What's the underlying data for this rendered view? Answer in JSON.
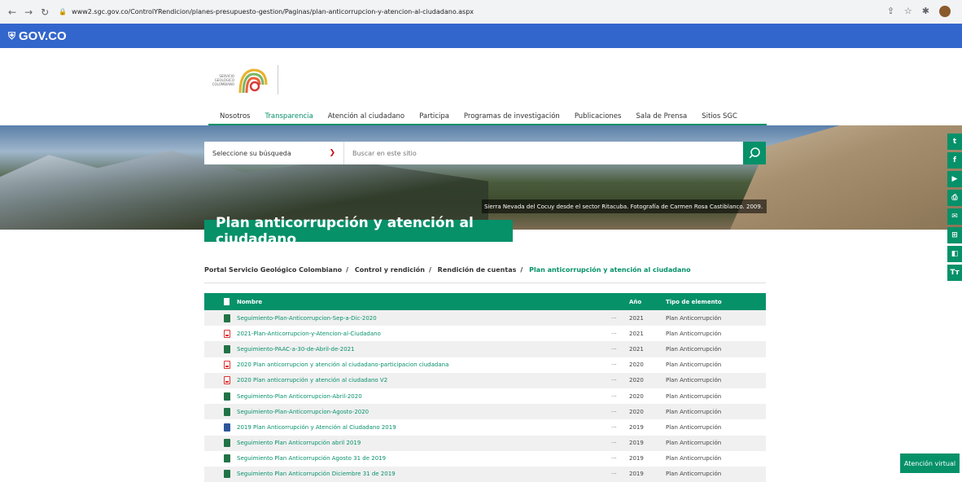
{
  "browser": {
    "url": "www2.sgc.gov.co/ControlYRendicion/planes-presupuesto-gestion/Paginas/plan-anticorrupcion-y-atencion-al-ciudadano.aspx"
  },
  "gov_bar": {
    "label": "GOV.CO"
  },
  "logo": {
    "line1": "SERVICIO",
    "line2": "GEOLÓGICO",
    "line3": "COLOMBIANO"
  },
  "nav": {
    "items": [
      {
        "label": "Nosotros",
        "active": false
      },
      {
        "label": "Transparencia",
        "active": true
      },
      {
        "label": "Atención al ciudadano",
        "active": false
      },
      {
        "label": "Participa",
        "active": false
      },
      {
        "label": "Programas de investigación",
        "active": false
      },
      {
        "label": "Publicaciones",
        "active": false
      },
      {
        "label": "Sala de Prensa",
        "active": false
      },
      {
        "label": "Sitios SGC",
        "active": false
      }
    ]
  },
  "search": {
    "select_label": "Seleccione su búsqueda",
    "placeholder": "Buscar en este sitio"
  },
  "hero": {
    "caption": "Sierra Nevada del Cocuy desde el sector Ritacuba. Fotografía de Carmen Rosa Castiblanco. 2009.",
    "title": "Plan anticorrupción y atención al ciudadano"
  },
  "breadcrumb": {
    "items": [
      "Portal Servicio Geológico Colombiano",
      "Control y rendición",
      "Rendición de cuentas"
    ],
    "current": "Plan anticorrupción y atención al ciudadano"
  },
  "table": {
    "headers": {
      "name": "Nombre",
      "year": "Año",
      "type": "Tipo de elemento"
    },
    "rows": [
      {
        "icon": "xls",
        "name": "Seguimiento-Plan-Anticorrupcion-Sep-a-Dic-2020",
        "year": "2021",
        "type": "Plan Anticorrupción"
      },
      {
        "icon": "pdf",
        "name": "2021-Plan-Anticorrupcion-y-Atencion-al-Ciudadano",
        "year": "2021",
        "type": "Plan Anticorrupción"
      },
      {
        "icon": "xls",
        "name": "Seguimiento-PAAC-a-30-de-Abril-de-2021",
        "year": "2021",
        "type": "Plan Anticorrupción"
      },
      {
        "icon": "pdf",
        "name": "2020 Plan anticorrupcion y atención al ciudadano-participacion ciudadana",
        "year": "2020",
        "type": "Plan Anticorrupción"
      },
      {
        "icon": "pdf",
        "name": "2020 Plan anticorrupción y atención al ciudadano V2",
        "year": "2020",
        "type": "Plan Anticorrupción"
      },
      {
        "icon": "xls",
        "name": "Seguimiento-Plan Anticorrupcion-Abril-2020",
        "year": "2020",
        "type": "Plan Anticorrupción"
      },
      {
        "icon": "xls",
        "name": "Seguimiento-Plan-Anticorrupcion-Agosto-2020",
        "year": "2020",
        "type": "Plan Anticorrupción"
      },
      {
        "icon": "doc",
        "name": "2019 Plan Anticorrupción y Atención al Ciudadano 2019",
        "year": "2019",
        "type": "Plan Anticorrupción"
      },
      {
        "icon": "xls",
        "name": "Seguimiento Plan Anticorrupción abril 2019",
        "year": "2019",
        "type": "Plan Anticorrupción"
      },
      {
        "icon": "xls",
        "name": "Seguimiento Plan Anticorrupción Agosto 31 de 2019",
        "year": "2019",
        "type": "Plan Anticorrupción"
      },
      {
        "icon": "xls",
        "name": "Seguimiento Plan Anticorrupción Diciembre 31 de 2019",
        "year": "2019",
        "type": "Plan Anticorrupción"
      }
    ]
  },
  "social": [
    "twitter-icon",
    "facebook-icon",
    "youtube-icon",
    "print-icon",
    "mail-icon",
    "sitemap-icon",
    "contrast-icon",
    "text-size-icon"
  ],
  "social_labels": {
    "text_size": "Tт"
  },
  "chat": {
    "label": "Atención virtual"
  },
  "colors": {
    "brand_green": "#069169",
    "gov_blue": "#3366cc"
  }
}
